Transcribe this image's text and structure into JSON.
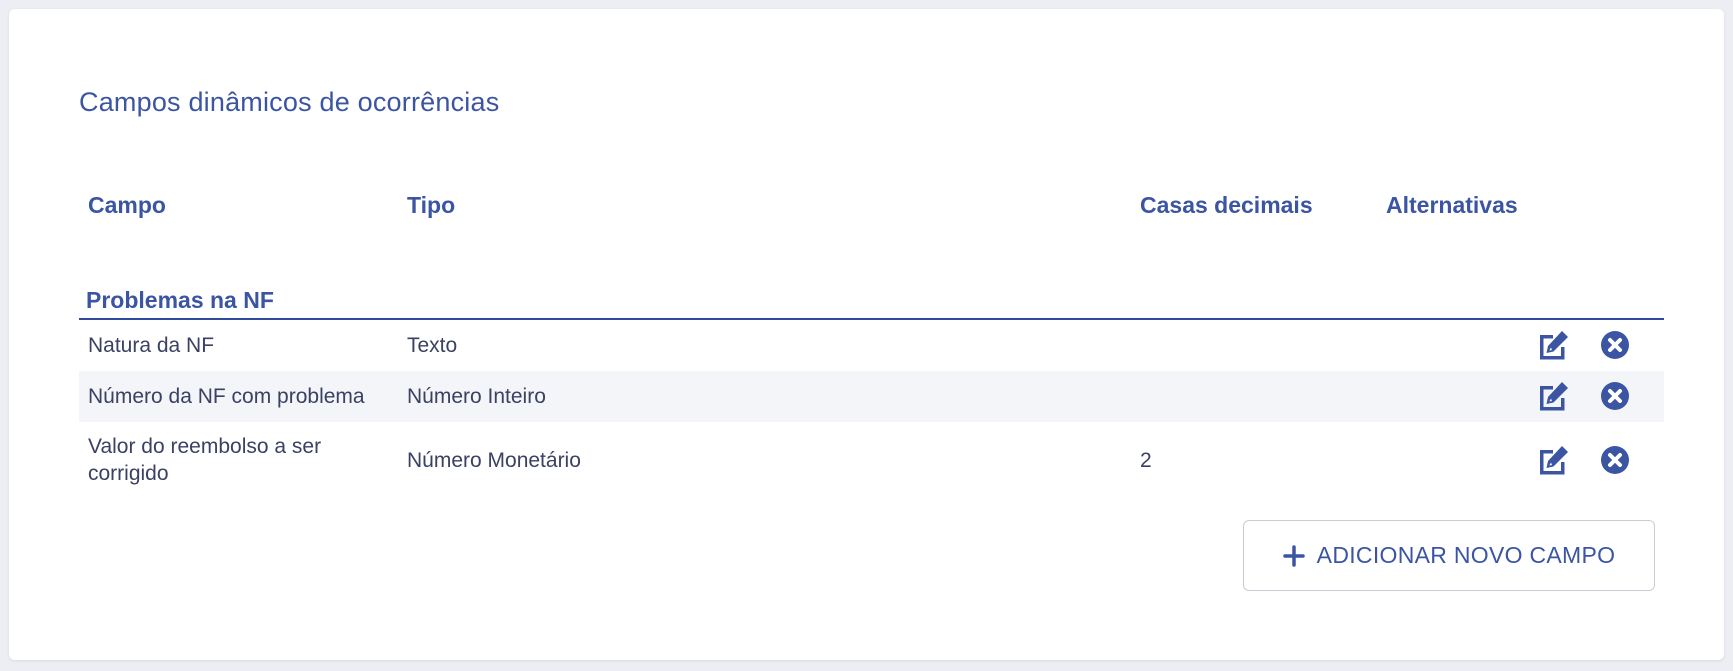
{
  "page": {
    "title": "Campos dinâmicos de ocorrências"
  },
  "table": {
    "headers": {
      "campo": "Campo",
      "tipo": "Tipo",
      "casas_decimais": "Casas decimais",
      "alternativas": "Alternativas"
    },
    "group": {
      "title": "Problemas na NF",
      "rows": [
        {
          "campo": "Natura da NF",
          "tipo": "Texto",
          "casas_decimais": "",
          "alternativas": ""
        },
        {
          "campo": "Número da NF com problema",
          "tipo": "Número Inteiro",
          "casas_decimais": "",
          "alternativas": ""
        },
        {
          "campo_line1": "Valor do reembolso a ser",
          "campo_line2": "corrigido",
          "tipo": "Número Monetário",
          "casas_decimais": "2",
          "alternativas": ""
        }
      ]
    }
  },
  "actions": {
    "add_label": "ADICIONAR NOVO CAMPO",
    "edit_icon": "edit-icon",
    "delete_icon": "delete-circle-x-icon"
  },
  "colors": {
    "accent": "#3b55a3",
    "text": "#3b4163",
    "row_alt": "#f4f5f8",
    "background": "#eceef3"
  }
}
